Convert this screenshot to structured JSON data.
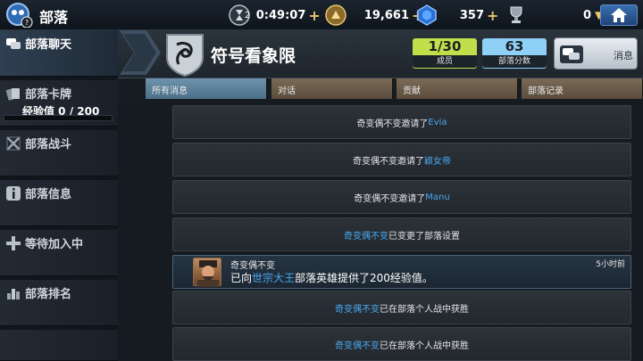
{
  "topbar": {
    "title": "部落",
    "timer_count": "2",
    "timer": "0:49:07",
    "gold": "19,661",
    "gems": "357",
    "trophies": "0"
  },
  "sidebar": {
    "items": [
      {
        "label": "部落聊天",
        "icon": "chat-icon"
      },
      {
        "label": "部落卡牌",
        "icon": "cards-icon"
      },
      {
        "label": "部落战斗",
        "icon": "swords-icon"
      },
      {
        "label": "部落信息",
        "icon": "info-icon"
      },
      {
        "label": "等待加入中",
        "icon": "plus-icon"
      },
      {
        "label": "部落排名",
        "icon": "ranking-icon"
      }
    ],
    "xp_label": "经验值 0 / 200",
    "xp_progress": 0.0
  },
  "header": {
    "clan_name": "符号看象限",
    "members_value": "1/30",
    "members_caption": "成员",
    "score_value": "63",
    "score_caption": "部落分数",
    "message_button": "消息"
  },
  "tabs": [
    "所有消息",
    "对话",
    "贡献",
    "部落记录"
  ],
  "feed": [
    {
      "pre": "奇变偶不变邀请了",
      "hl": "Evia",
      "post": ""
    },
    {
      "pre": "奇变偶不变邀请了",
      "hl": "颖女帝",
      "post": ""
    },
    {
      "pre": "奇变偶不变邀请了",
      "hl": "Manu",
      "post": ""
    },
    {
      "pre": "",
      "hl": "奇变偶不变",
      "post": "已变更了部落设置"
    },
    {
      "name": "奇变偶不变",
      "time": "5小时前",
      "msg_pre": "已向",
      "msg_hl": "世宗大王",
      "msg_post": "部落英雄提供了200经验值。"
    },
    {
      "pre": "",
      "hl": "奇变偶不变",
      "post": "已在部落个人战中获胜"
    },
    {
      "pre": "",
      "hl": "奇变偶不变",
      "post": "已在部落个人战中获胜"
    }
  ],
  "colors": {
    "accent_blue": "#4aa8ef",
    "members_box": "#bfe04a",
    "score_box": "#8fd0f6",
    "gold": "#e9c56a"
  }
}
